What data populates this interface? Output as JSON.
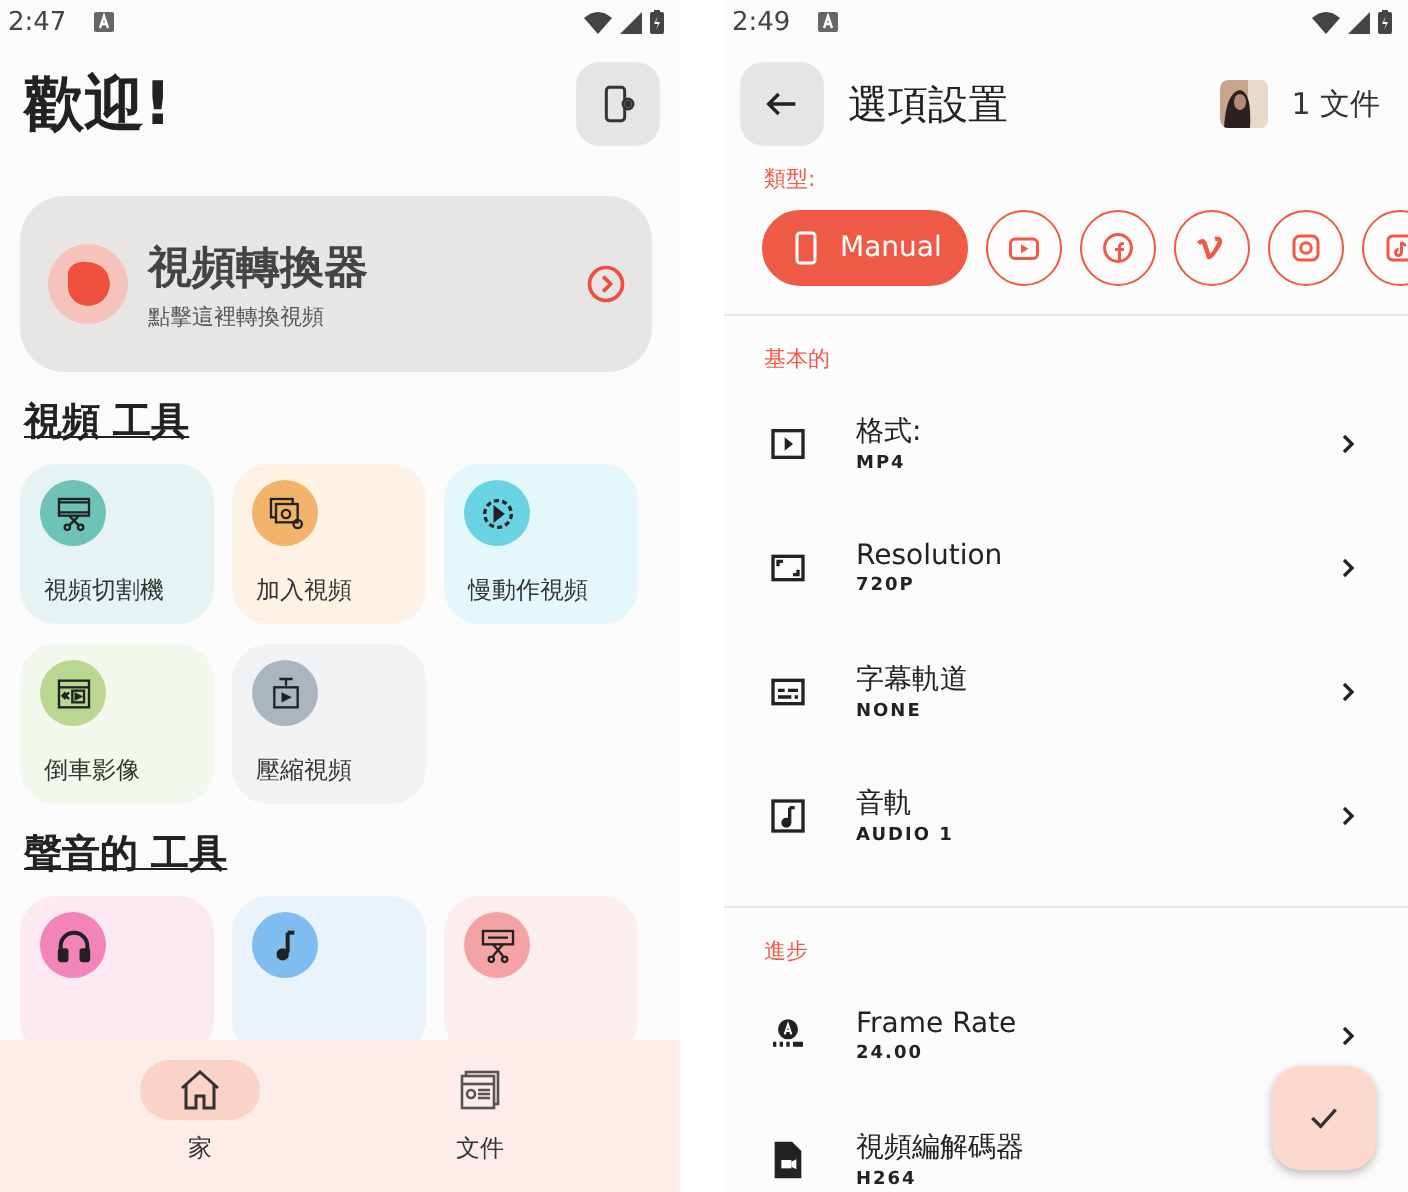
{
  "home": {
    "status_bar": {
      "time": "2:47"
    },
    "greeting": "歡迎!",
    "converter": {
      "title": "視頻轉換器",
      "subtitle": "點擊這裡轉換視頻"
    },
    "sections": [
      {
        "title": "視頻 工具",
        "tools": [
          {
            "kind": "cutter",
            "label": "視頻切割機",
            "color": "#6cc3b6"
          },
          {
            "kind": "merge",
            "label": "加入視頻",
            "color": "#f2b46a"
          },
          {
            "kind": "slow",
            "label": "慢動作視頻",
            "color": "#6ad3e3"
          },
          {
            "kind": "reverse",
            "label": "倒車影像",
            "color": "#b9d790"
          },
          {
            "kind": "compress",
            "label": "壓縮視頻",
            "color": "#a9b6bd"
          }
        ]
      },
      {
        "title": "聲音的 工具",
        "tools": [
          {
            "kind": "headphones",
            "color": "#f184b8"
          },
          {
            "kind": "note",
            "color": "#7fbdf0"
          },
          {
            "kind": "audio-cut",
            "color": "#f4a3a3"
          }
        ]
      }
    ],
    "nav": [
      {
        "kind": "home",
        "label": "家",
        "selected": true
      },
      {
        "kind": "files",
        "label": "文件",
        "selected": false
      }
    ]
  },
  "options": {
    "status_bar": {
      "time": "2:49"
    },
    "title": "選項設置",
    "file_count": "1 文件",
    "type_label": "類型:",
    "types": [
      {
        "kind": "manual",
        "label": "Manual",
        "selected": true
      },
      {
        "kind": "youtube",
        "selected": false
      },
      {
        "kind": "facebook",
        "selected": false
      },
      {
        "kind": "vimeo",
        "selected": false
      },
      {
        "kind": "instagram",
        "selected": false
      },
      {
        "kind": "tiktok",
        "selected": false
      }
    ],
    "groups": [
      {
        "title": "基本的",
        "options": [
          {
            "kind": "format",
            "label": "格式:",
            "value": "MP4"
          },
          {
            "kind": "resolution",
            "label": "Resolution",
            "value": "720P"
          },
          {
            "kind": "subtitle",
            "label": "字幕軌道",
            "value": "NONE"
          },
          {
            "kind": "audio",
            "label": "音軌",
            "value": "AUDIO 1"
          }
        ]
      },
      {
        "title": "進步",
        "options": [
          {
            "kind": "framerate",
            "label": "Frame Rate",
            "value": "24.00"
          },
          {
            "kind": "codec",
            "label": "視頻編解碼器",
            "value": "H264"
          }
        ]
      }
    ]
  }
}
